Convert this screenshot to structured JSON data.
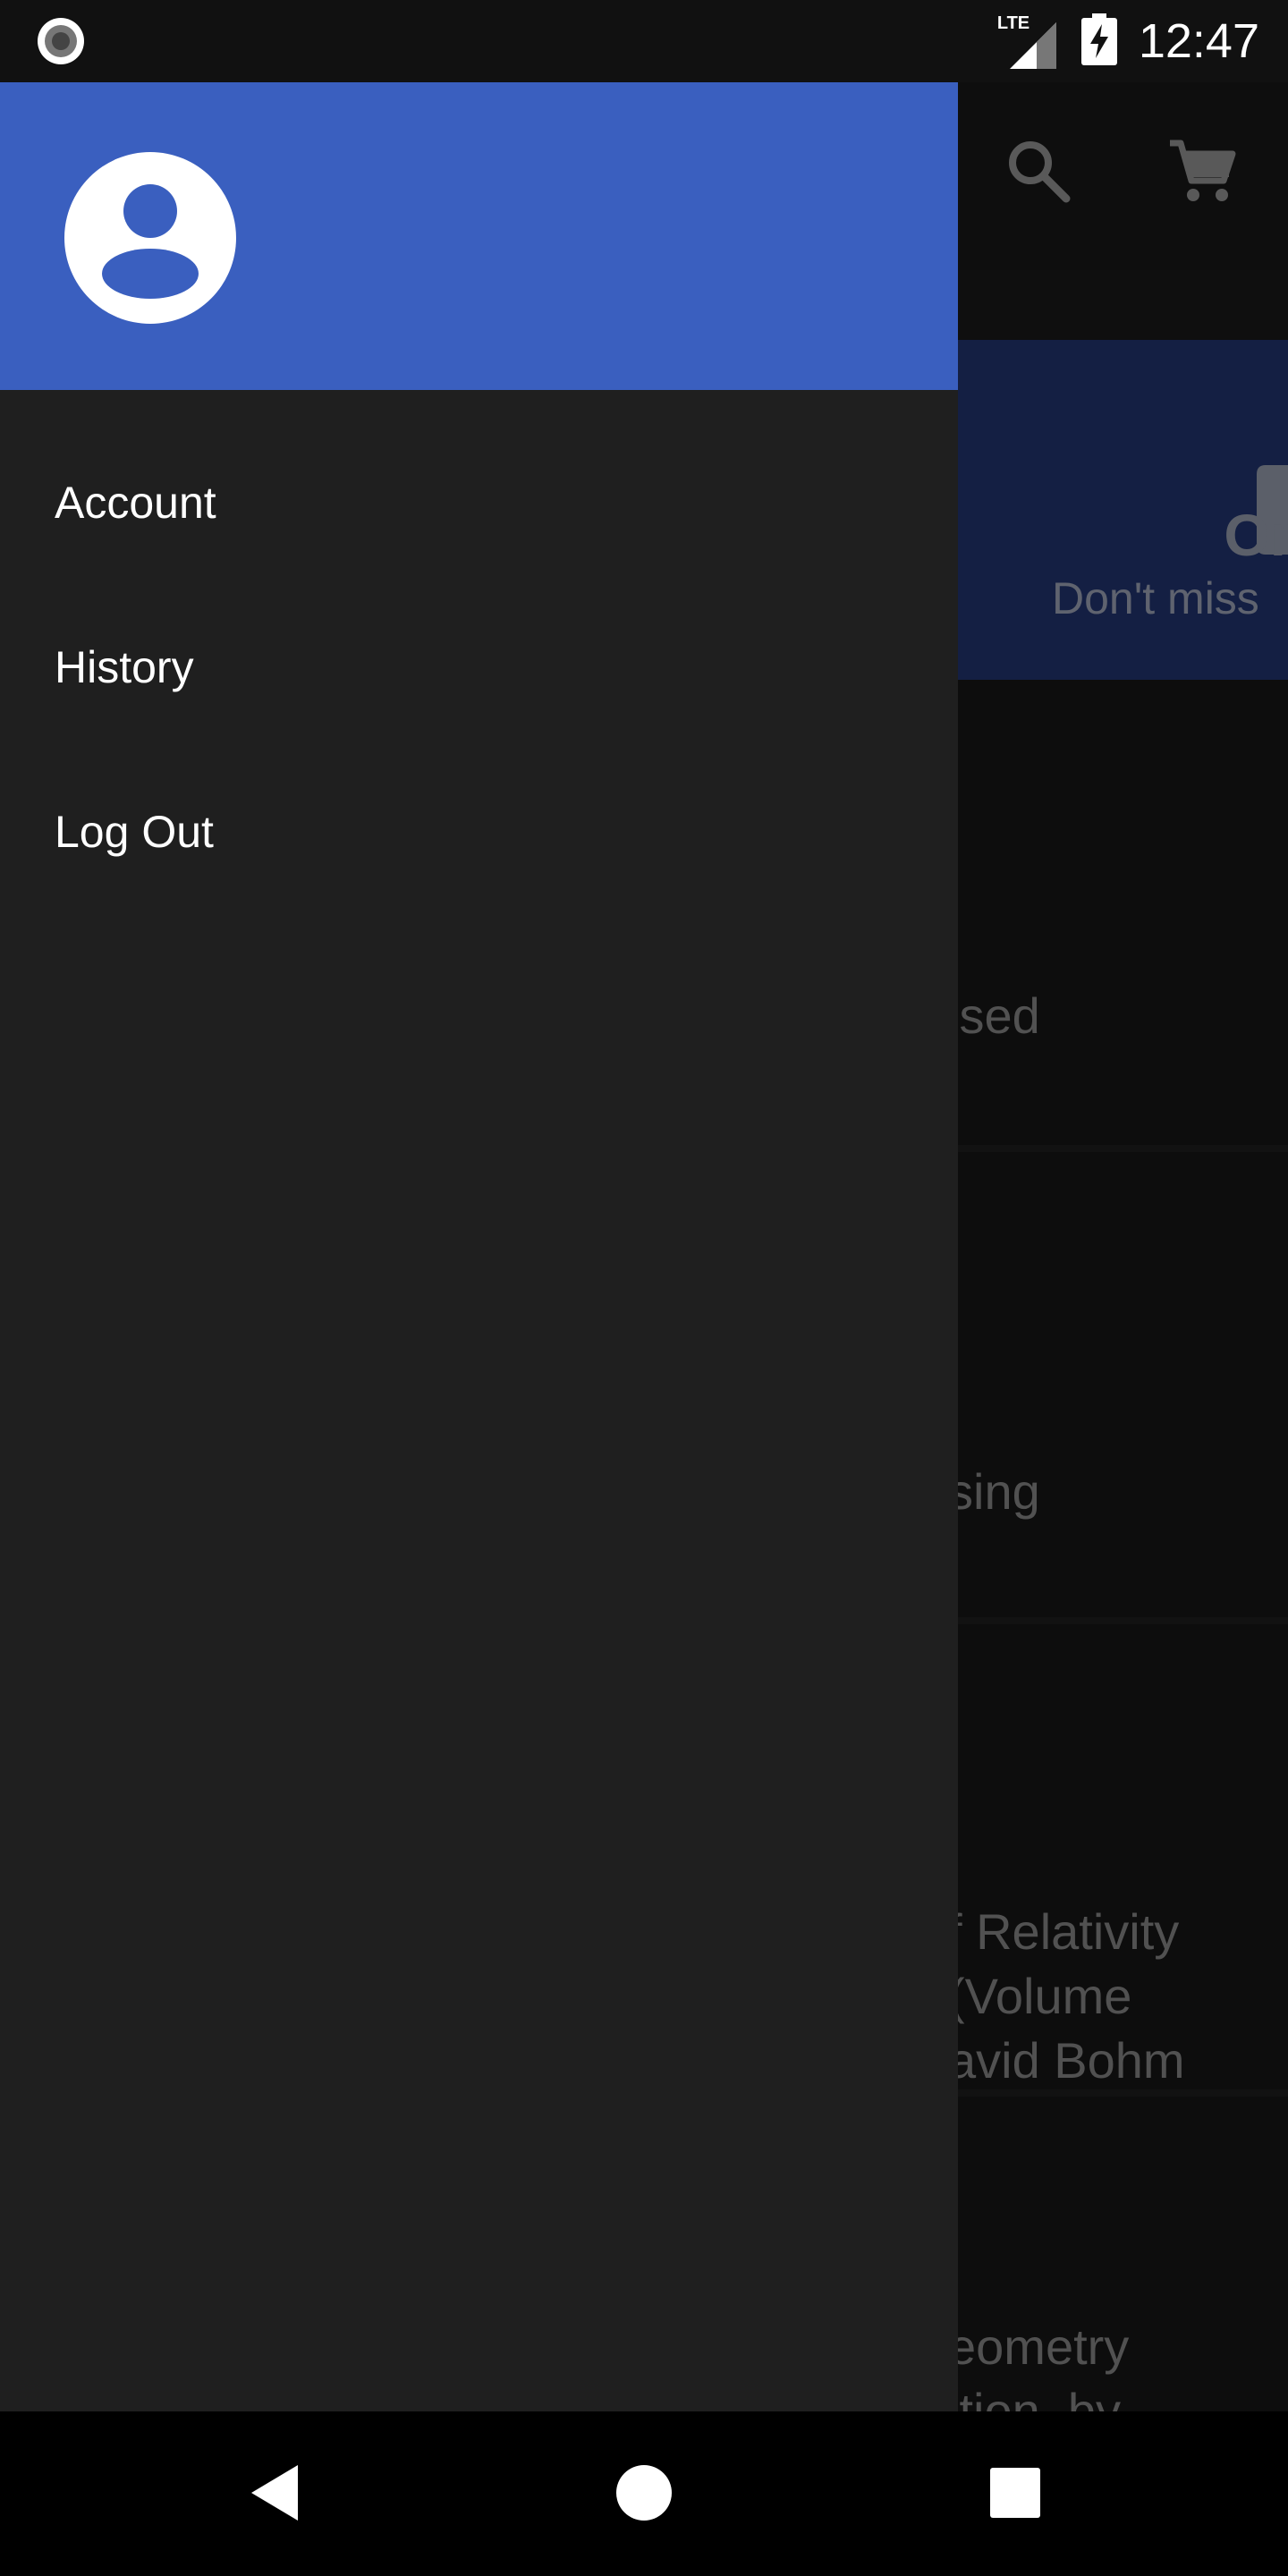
{
  "status_bar": {
    "network": "LTE",
    "time": "12:47"
  },
  "background": {
    "banner": {
      "title_fragment": "On",
      "subtitle_fragment": "Don't miss"
    },
    "items": [
      "ised",
      "sing",
      "f Relativity\n(Volume\navid Bohm",
      "eometry\nition, by"
    ]
  },
  "drawer": {
    "header_color": "#3a5fbf",
    "menu": [
      {
        "label": "Account"
      },
      {
        "label": "History"
      },
      {
        "label": "Log Out"
      }
    ]
  },
  "icons": {
    "status_left": "record-indicator-icon",
    "search": "search-icon",
    "cart": "cart-icon",
    "avatar": "account-circle-icon",
    "back": "back-icon",
    "home": "home-icon",
    "recents": "recents-icon"
  }
}
